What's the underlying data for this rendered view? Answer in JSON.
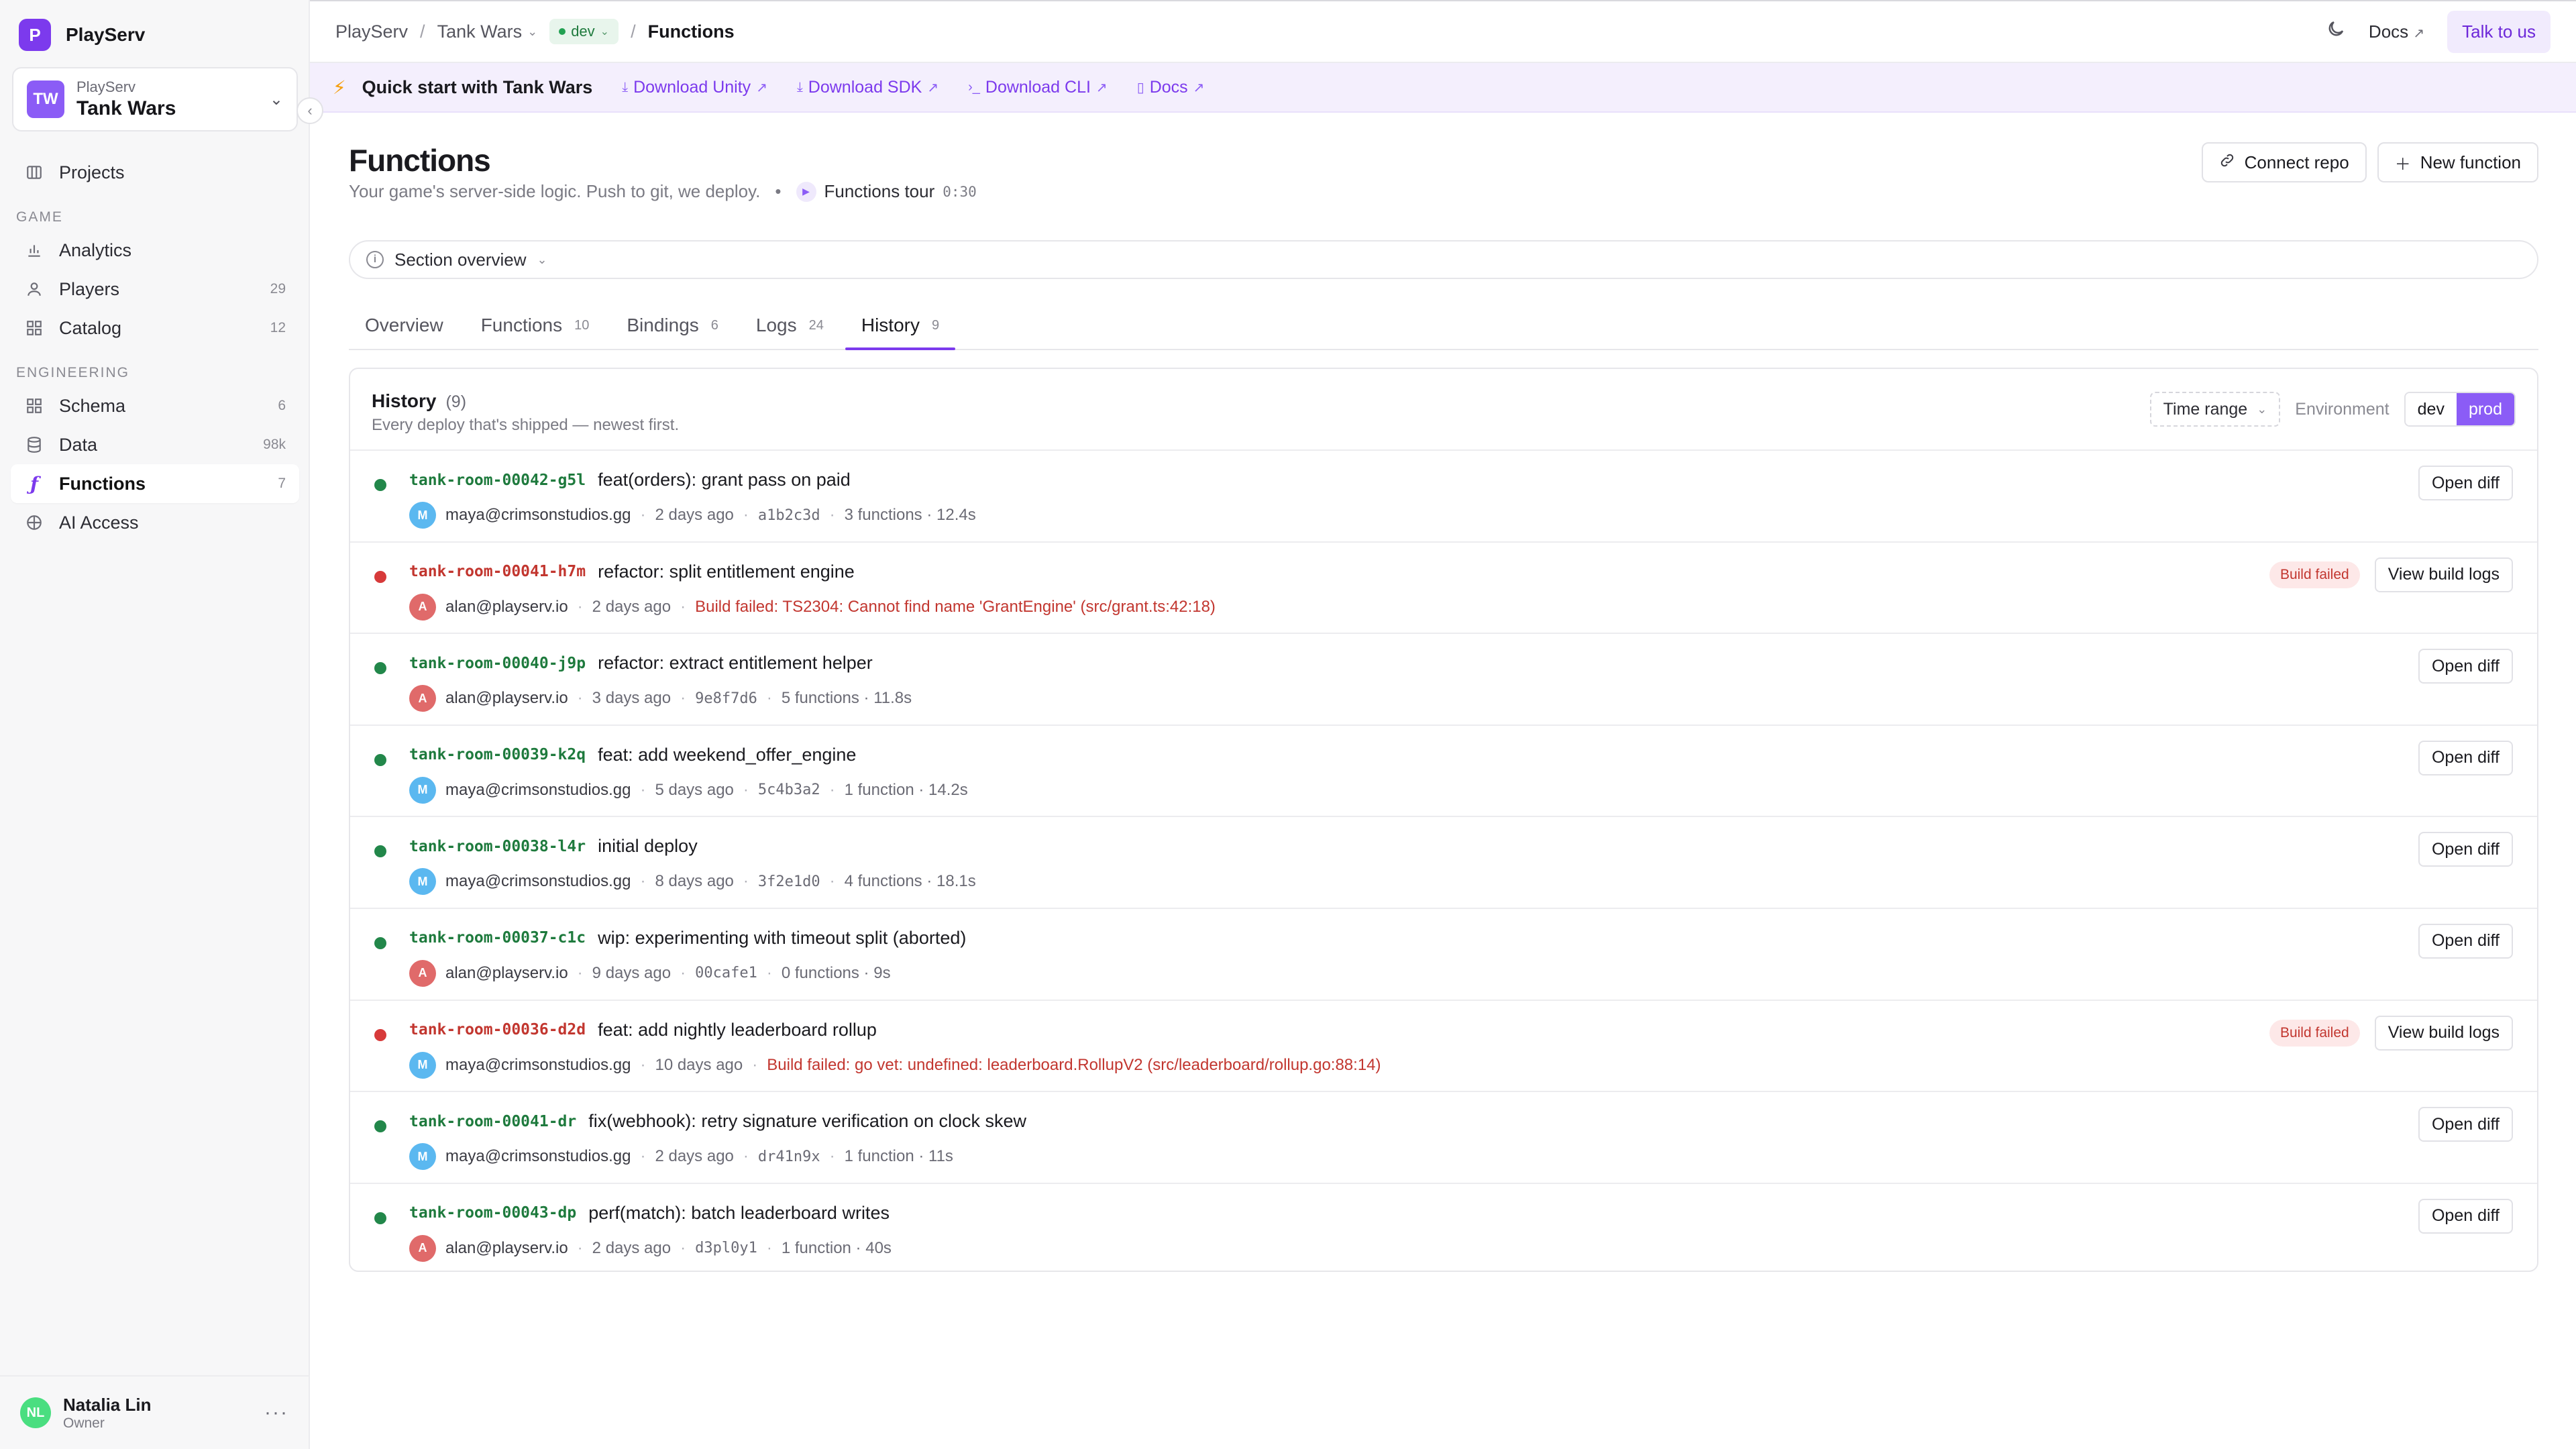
{
  "sidebar": {
    "brand": {
      "logo_letter": "P",
      "name": "PlayServ",
      "accent": "#7c3aed"
    },
    "project": {
      "initials": "TW",
      "org": "PlayServ",
      "name": "Tank Wars"
    },
    "top_items": [
      {
        "label": "Projects",
        "icon": "projects-icon"
      }
    ],
    "sections": [
      {
        "title": "GAME",
        "items": [
          {
            "label": "Analytics",
            "icon": "bar-chart-icon",
            "count": ""
          },
          {
            "label": "Players",
            "icon": "user-icon",
            "count": "29"
          },
          {
            "label": "Catalog",
            "icon": "grid-icon",
            "count": "12"
          }
        ]
      },
      {
        "title": "ENGINEERING",
        "items": [
          {
            "label": "Schema",
            "icon": "schema-icon",
            "count": "6"
          },
          {
            "label": "Data",
            "icon": "database-icon",
            "count": "98k"
          },
          {
            "label": "Functions",
            "icon": "function-icon",
            "count": "7",
            "active": true
          },
          {
            "label": "AI Access",
            "icon": "globe-icon",
            "count": ""
          }
        ]
      }
    ],
    "user": {
      "initials": "NL",
      "name": "Natalia Lin",
      "role": "Owner"
    }
  },
  "topbar": {
    "crumb_root": "PlayServ",
    "crumb_project": "Tank Wars",
    "env": "dev",
    "crumb_current": "Functions",
    "docs": "Docs",
    "talk": "Talk to us"
  },
  "quickstart": {
    "title": "Quick start with Tank Wars",
    "links": [
      {
        "label": "Download Unity",
        "icon": "download-icon"
      },
      {
        "label": "Download SDK",
        "icon": "download-icon"
      },
      {
        "label": "Download CLI",
        "icon": "terminal-icon"
      },
      {
        "label": "Docs",
        "icon": "doc-icon"
      }
    ]
  },
  "page": {
    "title": "Functions",
    "subtitle": "Your game's server-side logic. Push to git, we deploy.",
    "tour_label": "Functions tour",
    "tour_time": "0:30",
    "connect_repo": "Connect repo",
    "new_function": "New function",
    "section_overview": "Section overview"
  },
  "tabs": [
    {
      "label": "Overview",
      "count": ""
    },
    {
      "label": "Functions",
      "count": "10"
    },
    {
      "label": "Bindings",
      "count": "6"
    },
    {
      "label": "Logs",
      "count": "24"
    },
    {
      "label": "History",
      "count": "9",
      "active": true
    }
  ],
  "history": {
    "title": "History",
    "count": "(9)",
    "subtitle": "Every deploy that's shipped — newest first.",
    "time_range": "Time range",
    "env_label": "Environment",
    "env_options": [
      "dev",
      "prod"
    ],
    "env_selected": "prod",
    "rows": [
      {
        "id": "tank-room-00042-g5l",
        "msg": "feat(orders): grant pass on paid",
        "user": "maya@crimsonstudios.gg",
        "av": "M",
        "when": "2 days ago",
        "hash": "a1b2c3d",
        "stats": "3 functions · 12.4s",
        "status": "ok",
        "action": "Open diff"
      },
      {
        "id": "tank-room-00041-h7m",
        "msg": "refactor: split entitlement engine",
        "user": "alan@playserv.io",
        "av": "A",
        "when": "2 days ago",
        "error": "Build failed: TS2304: Cannot find name 'GrantEngine' (src/grant.ts:42:18)",
        "status": "fail",
        "badge": "Build failed",
        "action": "View build logs"
      },
      {
        "id": "tank-room-00040-j9p",
        "msg": "refactor: extract entitlement helper",
        "user": "alan@playserv.io",
        "av": "A",
        "when": "3 days ago",
        "hash": "9e8f7d6",
        "stats": "5 functions · 11.8s",
        "status": "ok",
        "action": "Open diff"
      },
      {
        "id": "tank-room-00039-k2q",
        "msg": "feat: add weekend_offer_engine",
        "user": "maya@crimsonstudios.gg",
        "av": "M",
        "when": "5 days ago",
        "hash": "5c4b3a2",
        "stats": "1 function · 14.2s",
        "status": "ok",
        "action": "Open diff"
      },
      {
        "id": "tank-room-00038-l4r",
        "msg": "initial deploy",
        "user": "maya@crimsonstudios.gg",
        "av": "M",
        "when": "8 days ago",
        "hash": "3f2e1d0",
        "stats": "4 functions · 18.1s",
        "status": "ok",
        "action": "Open diff"
      },
      {
        "id": "tank-room-00037-c1c",
        "msg": "wip: experimenting with timeout split (aborted)",
        "user": "alan@playserv.io",
        "av": "A",
        "when": "9 days ago",
        "hash": "00cafe1",
        "stats": "0 functions · 9s",
        "status": "ok",
        "action": "Open diff"
      },
      {
        "id": "tank-room-00036-d2d",
        "msg": "feat: add nightly leaderboard rollup",
        "user": "maya@crimsonstudios.gg",
        "av": "M",
        "when": "10 days ago",
        "error": "Build failed: go vet: undefined: leaderboard.RollupV2 (src/leaderboard/rollup.go:88:14)",
        "status": "fail",
        "badge": "Build failed",
        "action": "View build logs"
      },
      {
        "id": "tank-room-00041-dr",
        "msg": "fix(webhook): retry signature verification on clock skew",
        "user": "maya@crimsonstudios.gg",
        "av": "M",
        "when": "2 days ago",
        "hash": "dr41n9x",
        "stats": "1 function · 11s",
        "status": "ok",
        "action": "Open diff"
      },
      {
        "id": "tank-room-00043-dp",
        "msg": "perf(match): batch leaderboard writes",
        "user": "alan@playserv.io",
        "av": "A",
        "when": "2 days ago",
        "hash": "d3pl0y1",
        "stats": "1 function · 40s",
        "status": "ok",
        "action": "Open diff"
      }
    ]
  }
}
